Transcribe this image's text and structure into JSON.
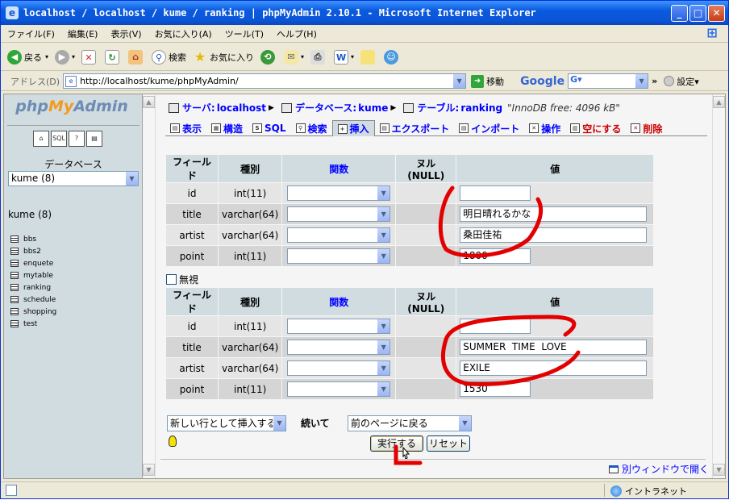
{
  "window": {
    "title": "localhost / localhost / kume / ranking | phpMyAdmin 2.10.1 - Microsoft Internet Explorer"
  },
  "menu": [
    "ファイル(F)",
    "編集(E)",
    "表示(V)",
    "お気に入り(A)",
    "ツール(T)",
    "ヘルプ(H)"
  ],
  "toolbar": {
    "back": "戻る",
    "search": "検索",
    "favorites": "お気に入り"
  },
  "address": {
    "label": "アドレス(D)",
    "url": "http://localhost/kume/phpMyAdmin/",
    "go": "移動",
    "google": "Google",
    "google_g": "G▾",
    "settings": "設定▾"
  },
  "left": {
    "db_label": "データベース",
    "db_select": "kume (8)",
    "db_title": "kume (8)",
    "tables": [
      "bbs",
      "bbs2",
      "enquete",
      "mytable",
      "ranking",
      "schedule",
      "shopping",
      "test"
    ]
  },
  "breadcrumb": {
    "server_label": "サーバ:",
    "server": "localhost",
    "db_label": "データベース:",
    "db": "kume",
    "table_label": "テーブル:",
    "table": "ranking",
    "info": "\"InnoDB free: 4096 kB\""
  },
  "tabs": [
    {
      "label": "表示",
      "icon": "browse-icon"
    },
    {
      "label": "構造",
      "icon": "structure-icon"
    },
    {
      "label": "SQL",
      "icon": "sql-icon"
    },
    {
      "label": "検索",
      "icon": "search-icon"
    },
    {
      "label": "挿入",
      "icon": "insert-icon"
    },
    {
      "label": "エクスポート",
      "icon": "export-icon"
    },
    {
      "label": "インポート",
      "icon": "import-icon"
    },
    {
      "label": "操作",
      "icon": "operations-icon"
    },
    {
      "label": "空にする",
      "icon": "empty-icon"
    },
    {
      "label": "削除",
      "icon": "drop-icon"
    }
  ],
  "columns": {
    "field": "フィールド",
    "type": "種別",
    "function": "関数",
    "null": "ヌル(NULL)",
    "value": "値"
  },
  "form1": [
    {
      "field": "id",
      "type": "int(11)",
      "value": ""
    },
    {
      "field": "title",
      "type": "varchar(64)",
      "value": "明日晴れるかな"
    },
    {
      "field": "artist",
      "type": "varchar(64)",
      "value": "桑田佳祐"
    },
    {
      "field": "point",
      "type": "int(11)",
      "value": "1800"
    }
  ],
  "ignore_label": "無視",
  "form2": [
    {
      "field": "id",
      "type": "int(11)",
      "value": ""
    },
    {
      "field": "title",
      "type": "varchar(64)",
      "value": "SUMMER  TIME  LOVE"
    },
    {
      "field": "artist",
      "type": "varchar(64)",
      "value": "EXILE"
    },
    {
      "field": "point",
      "type": "int(11)",
      "value": "1530"
    }
  ],
  "bottom": {
    "action_select": "新しい行として挿入する",
    "after_label": "続いて",
    "after_select": "前のページに戻る",
    "execute": "実行する",
    "reset": "リセット",
    "new_window": "別ウィンドウで開く"
  },
  "status": {
    "zone": "イントラネット"
  },
  "colors": {
    "annotation": "#e30000",
    "link": "#0000ff",
    "header_bg": "#d0dce0"
  }
}
